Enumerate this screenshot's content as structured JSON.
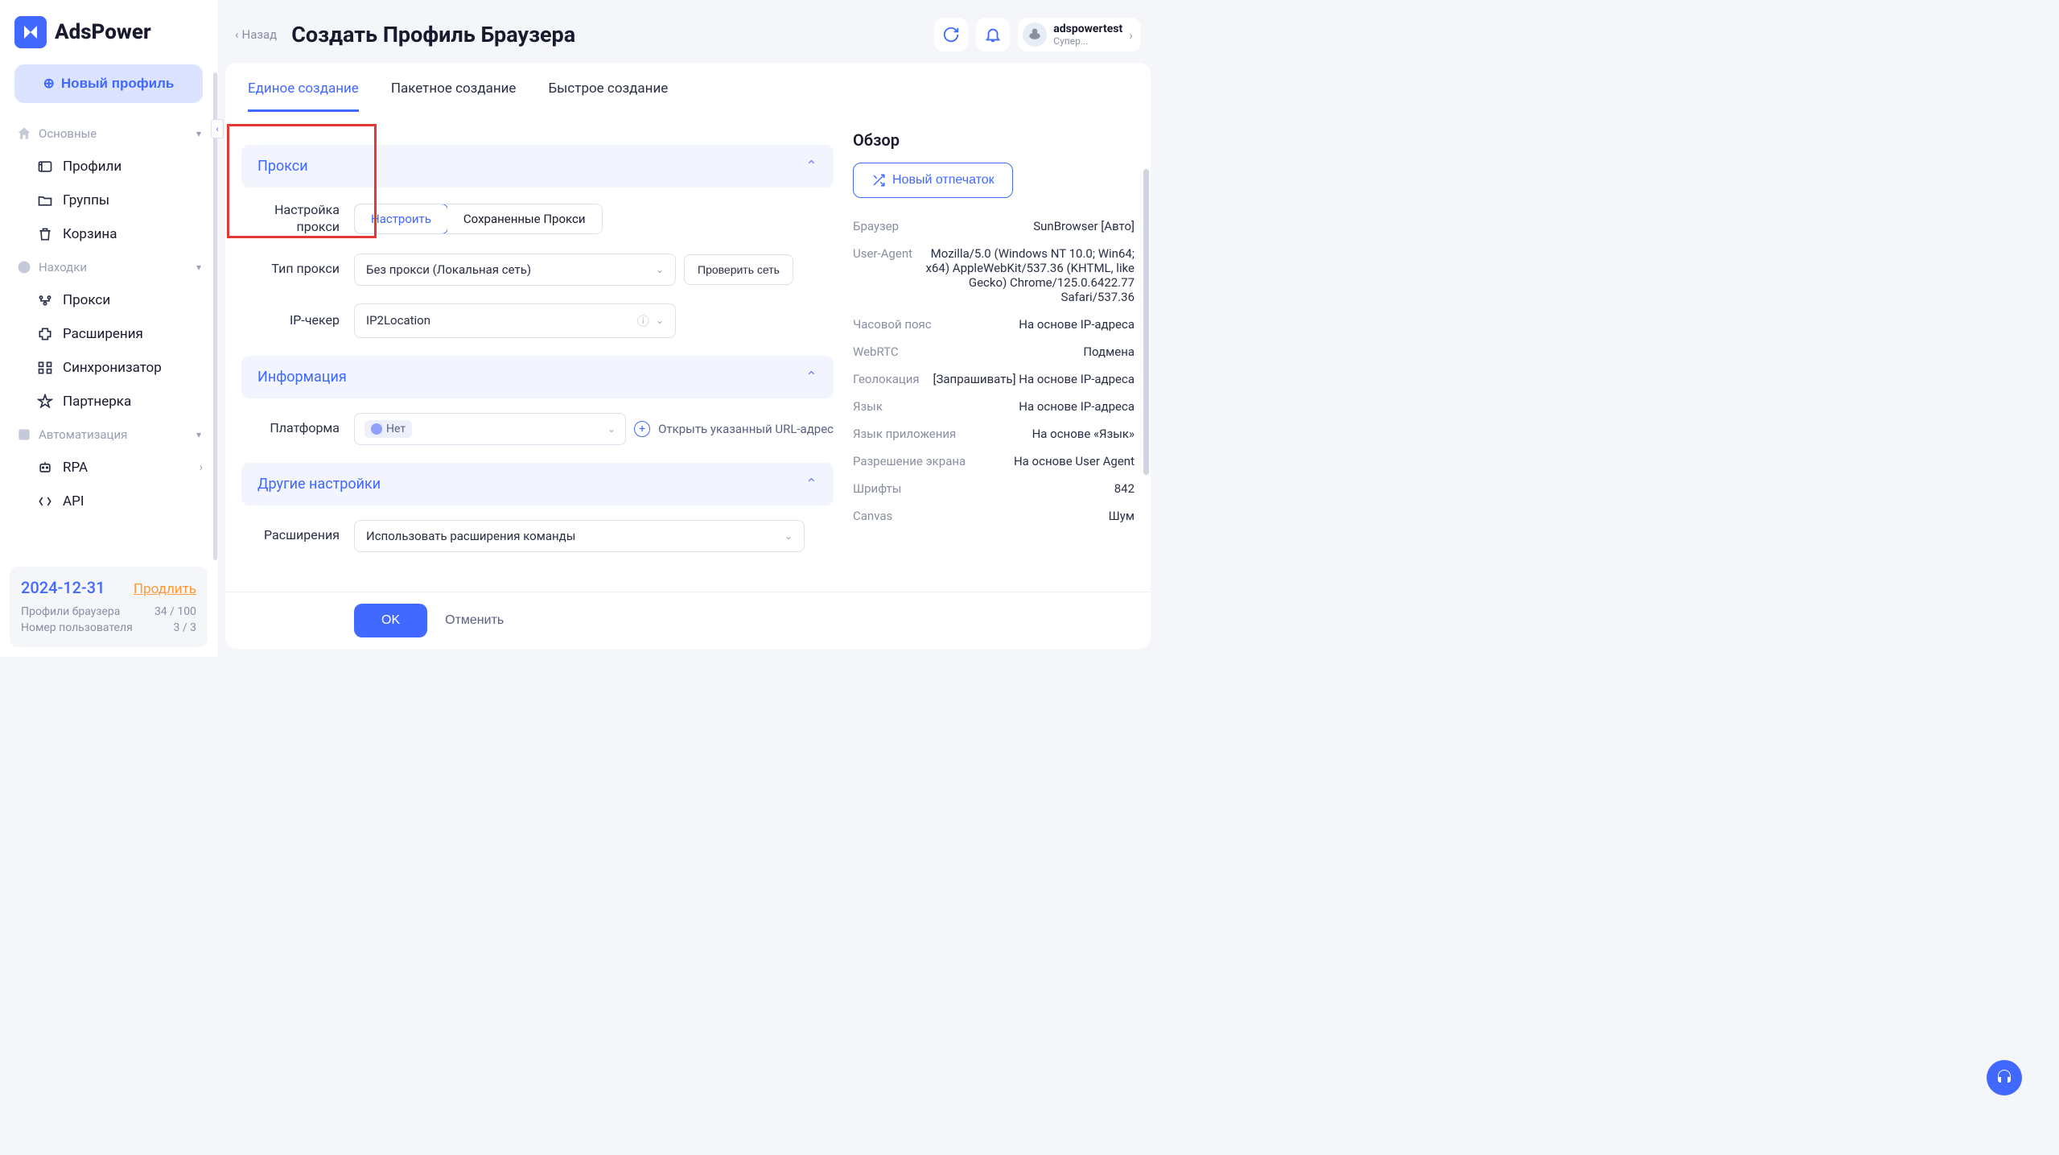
{
  "brand": "AdsPower",
  "sidebar": {
    "newProfile": "Новый профиль",
    "sections": {
      "basics": {
        "label": "Основные",
        "items": [
          "Профили",
          "Группы",
          "Корзина"
        ]
      },
      "finds": {
        "label": "Находки",
        "items": [
          "Прокси",
          "Расширения",
          "Синхронизатор",
          "Партнерка"
        ]
      },
      "auto": {
        "label": "Автоматизация",
        "items": [
          "RPA",
          "API"
        ]
      }
    },
    "footer": {
      "date": "2024-12-31",
      "extend": "Продлить",
      "stats": [
        {
          "label": "Профили браузера",
          "value": "34 / 100"
        },
        {
          "label": "Номер пользователя",
          "value": "3 / 3"
        }
      ]
    }
  },
  "header": {
    "back": "Назад",
    "title": "Создать Профиль Браузера",
    "user": {
      "name": "adspowertest",
      "role": "Супер..."
    }
  },
  "tabs": [
    "Единое создание",
    "Пакетное создание",
    "Быстрое создание"
  ],
  "sections": {
    "proxy": {
      "title": "Прокси",
      "proxySetting": {
        "label": "Настройка прокси",
        "opts": [
          "Настроить",
          "Сохраненные Прокси"
        ]
      },
      "proxyType": {
        "label": "Тип прокси",
        "value": "Без прокси (Локальная сеть)",
        "check": "Проверить сеть"
      },
      "ipChecker": {
        "label": "IP-чекер",
        "value": "IP2Location"
      }
    },
    "info": {
      "title": "Информация",
      "platform": {
        "label": "Платформа",
        "value": "Нет",
        "linkText": "Открыть указанный URL-адрес"
      }
    },
    "other": {
      "title": "Другие настройки",
      "extensions": {
        "label": "Расширения",
        "value": "Использовать расширения команды"
      }
    }
  },
  "summary": {
    "title": "Обзор",
    "fingerprintBtn": "Новый отпечаток",
    "rows": [
      {
        "k": "Браузер",
        "v": "SunBrowser [Авто]"
      },
      {
        "k": "User-Agent",
        "v": "Mozilla/5.0 (Windows NT 10.0; Win64; x64) AppleWebKit/537.36 (KHTML, like Gecko) Chrome/125.0.6422.77 Safari/537.36"
      },
      {
        "k": "Часовой пояс",
        "v": "На основе IP-адреса"
      },
      {
        "k": "WebRTC",
        "v": "Подмена"
      },
      {
        "k": "Геолокация",
        "v": "[Запрашивать] На основе IP-адреса"
      },
      {
        "k": "Язык",
        "v": "На основе IP-адреса"
      },
      {
        "k": "Язык приложения",
        "v": "На основе «Язык»"
      },
      {
        "k": "Разрешение экрана",
        "v": "На основе User Agent"
      },
      {
        "k": "Шрифты",
        "v": "842"
      },
      {
        "k": "Canvas",
        "v": "Шум"
      }
    ]
  },
  "footer": {
    "ok": "OK",
    "cancel": "Отменить"
  }
}
